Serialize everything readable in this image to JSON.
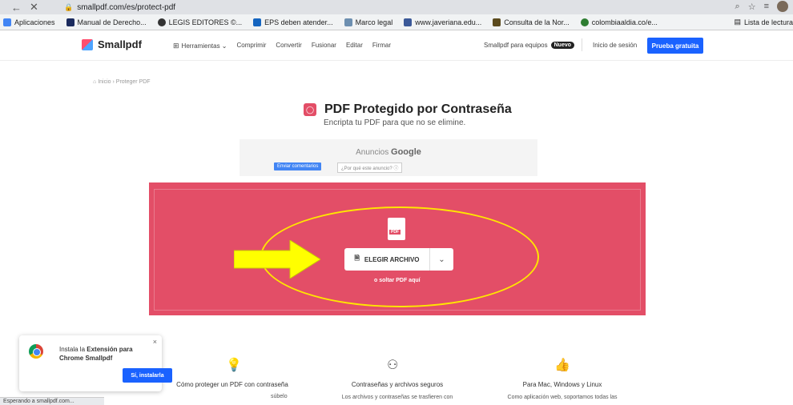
{
  "browser": {
    "url": "smallpdf.com/es/protect-pdf",
    "bookmarks": [
      {
        "label": "Aplicaciones",
        "color": "#4285f4"
      },
      {
        "label": "Manual de Derecho...",
        "color": "#1b2b5e"
      },
      {
        "label": "LEGIS EDITORES ©...",
        "color": "#333333"
      },
      {
        "label": "EPS deben atender...",
        "color": "#1565c0"
      },
      {
        "label": "Marco legal",
        "color": "#6d8fb0"
      },
      {
        "label": "www.javeriana.edu...",
        "color": "#3b5998"
      },
      {
        "label": "Consulta de la Nor...",
        "color": "#5c4b1e"
      },
      {
        "label": "colombiaaldia.co/e...",
        "color": "#2e7d32"
      }
    ],
    "reading_list": "Lista de lectura",
    "status": "Esperando a smallpdf.com..."
  },
  "header": {
    "logo": "Smallpdf",
    "menu": [
      "Herramientas",
      "Comprimir",
      "Convertir",
      "Fusionar",
      "Editar",
      "Firmar"
    ],
    "teams": "Smallpdf para equipos",
    "teams_badge": "Nuevo",
    "login": "Inicio de sesión",
    "trial": "Prueba gratuita"
  },
  "breadcrumb": {
    "home": "Inicio",
    "current": "Proteger PDF"
  },
  "main": {
    "title": "PDF Protegido por Contraseña",
    "subtitle": "Encripta tu PDF para que no se elimine."
  },
  "ad": {
    "label": "Anuncios",
    "brand": "Google",
    "send": "Enviar comentarios",
    "why": "¿Por qué este anuncio?"
  },
  "dropzone": {
    "file_badge": "PDF",
    "choose": "ELEGIR ARCHIVO",
    "drop_text": "o soltar PDF aquí",
    "bg_color": "#e34e67"
  },
  "extension": {
    "line1": "Instala la ",
    "line1_bold": "Extensión para",
    "line2_bold": "Chrome Smallpdf",
    "yes": "Sí, instalarla"
  },
  "features": [
    {
      "title": "Cómo proteger un PDF con contraseña",
      "desc": "súbelo"
    },
    {
      "title": "Contraseñas y archivos seguros",
      "desc": "Los archivos y contraseñas se trasfieren con"
    },
    {
      "title": "Para Mac, Windows y Linux",
      "desc": "Como aplicación web, soportamos todas las"
    }
  ]
}
